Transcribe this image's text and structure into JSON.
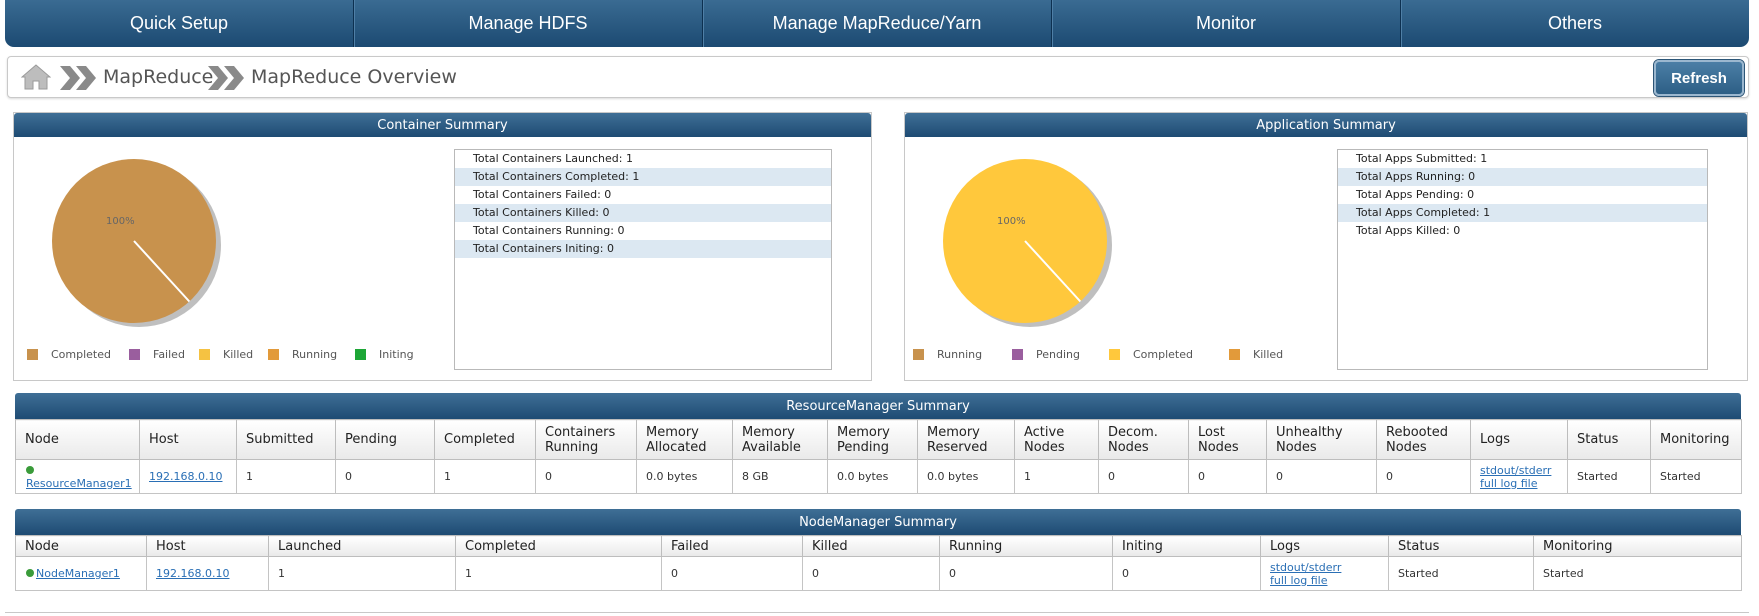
{
  "nav": {
    "items": [
      "Quick Setup",
      "Manage HDFS",
      "Manage MapReduce/Yarn",
      "Monitor",
      "Others"
    ]
  },
  "breadcrumb": {
    "level1": "MapReduce",
    "level2": "MapReduce Overview",
    "refresh_label": "Refresh"
  },
  "container_summary": {
    "title": "Container Summary",
    "pie_label": "100%",
    "legend": [
      {
        "label": "Completed",
        "color": "#c8924d"
      },
      {
        "label": "Failed",
        "color": "#9a5e9e"
      },
      {
        "label": "Killed",
        "color": "#f5c242"
      },
      {
        "label": "Running",
        "color": "#e29a3a"
      },
      {
        "label": "Initing",
        "color": "#1da636"
      }
    ],
    "stats": [
      "Total Containers Launched: 1",
      "Total Containers Completed: 1",
      "Total Containers Failed: 0",
      "Total Containers Killed: 0",
      "Total Containers Running: 0",
      "Total Containers Initing: 0"
    ],
    "chart_data": {
      "type": "pie",
      "categories": [
        "Completed",
        "Failed",
        "Killed",
        "Running",
        "Initing"
      ],
      "values": [
        1,
        0,
        0,
        0,
        0
      ],
      "slice_label": "100%"
    }
  },
  "application_summary": {
    "title": "Application Summary",
    "pie_label": "100%",
    "legend": [
      {
        "label": "Running",
        "color": "#c8924d"
      },
      {
        "label": "Pending",
        "color": "#9a5e9e"
      },
      {
        "label": "Completed",
        "color": "#ffc83c"
      },
      {
        "label": "Killed",
        "color": "#e29a3a"
      }
    ],
    "stats": [
      "Total Apps Submitted: 1",
      "Total Apps Running: 0",
      "Total Apps Pending: 0",
      "Total Apps Completed: 1",
      "Total Apps Killed: 0"
    ],
    "chart_data": {
      "type": "pie",
      "categories": [
        "Running",
        "Pending",
        "Completed",
        "Killed"
      ],
      "values": [
        0,
        0,
        1,
        0
      ],
      "slice_label": "100%"
    }
  },
  "rm_summary": {
    "title": "ResourceManager Summary",
    "headers": [
      "Node",
      "Host",
      "Submitted",
      "Pending",
      "Completed",
      "Containers Running",
      "Memory Allocated",
      "Memory Available",
      "Memory Pending",
      "Memory Reserved",
      "Active Nodes",
      "Decom. Nodes",
      "Lost Nodes",
      "Unhealthy Nodes",
      "Rebooted Nodes",
      "Logs",
      "Status",
      "Monitoring"
    ],
    "row": {
      "node": "ResourceManager1",
      "host": "192.168.0.10",
      "submitted": "1",
      "pending": "0",
      "completed": "1",
      "containers_running": "0",
      "memory_allocated": "0.0 bytes",
      "memory_available": "8 GB",
      "memory_pending": "0.0 bytes",
      "memory_reserved": "0.0 bytes",
      "active_nodes": "1",
      "decom_nodes": "0",
      "lost_nodes": "0",
      "unhealthy_nodes": "0",
      "rebooted_nodes": "0",
      "log_stdout": "stdout/stderr",
      "log_full": "full log file",
      "status": "Started",
      "monitoring": "Started"
    }
  },
  "nm_summary": {
    "title": "NodeManager Summary",
    "headers": [
      "Node",
      "Host",
      "Launched",
      "Completed",
      "Failed",
      "Killed",
      "Running",
      "Initing",
      "Logs",
      "Status",
      "Monitoring"
    ],
    "row": {
      "node": "NodeManager1",
      "host": "192.168.0.10",
      "launched": "1",
      "completed": "1",
      "failed": "0",
      "killed": "0",
      "running": "0",
      "initing": "0",
      "log_stdout": "stdout/stderr",
      "log_full": "full log file",
      "status": "Started",
      "monitoring": "Started"
    }
  }
}
